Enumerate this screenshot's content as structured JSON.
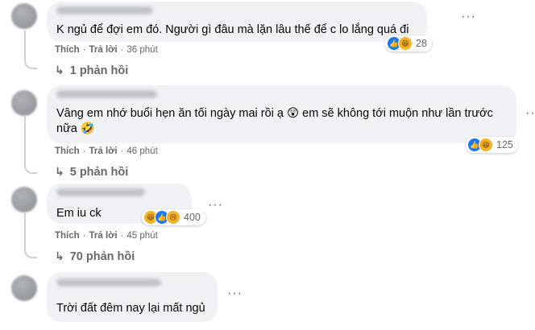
{
  "comments": [
    {
      "text": "K ngủ để đợi em đó. Người gì đâu mà lặn lâu thế để c lo lắng quá đi",
      "like_label": "Thích",
      "reply_label": "Trả lời",
      "time": "36 phút",
      "reaction_count": "28",
      "reactions": [
        "like-icon",
        "haha-icon"
      ],
      "replies_label": "1 phản hồi"
    },
    {
      "text_line1": "Vâng em nhớ buổi hẹn ăn tối ngày mai rồi ạ 😲 em sẽ không tới muộn như lần trước",
      "text_line2": "nữa 🤣",
      "like_label": "Thích",
      "reply_label": "Trả lời",
      "time": "46 phút",
      "reaction_count": "125",
      "reactions": [
        "like-icon",
        "haha-icon"
      ],
      "replies_label": "5 phản hồi"
    },
    {
      "text": "Em iu ck",
      "like_label": "Thích",
      "reply_label": "Trả lời",
      "time": "45 phút",
      "reaction_count": "400",
      "reactions": [
        "haha-icon",
        "like-icon",
        "sad-icon"
      ],
      "replies_label": "70 phản hồi"
    },
    {
      "text": "Trời đất đêm nay lại mất ngủ"
    }
  ],
  "more_options_label": "···",
  "colors": {
    "bubble": "#f0f2f5",
    "meta_text": "#65676b",
    "like_blue": "#1877f2",
    "emoji_yellow": "#f7b125"
  }
}
